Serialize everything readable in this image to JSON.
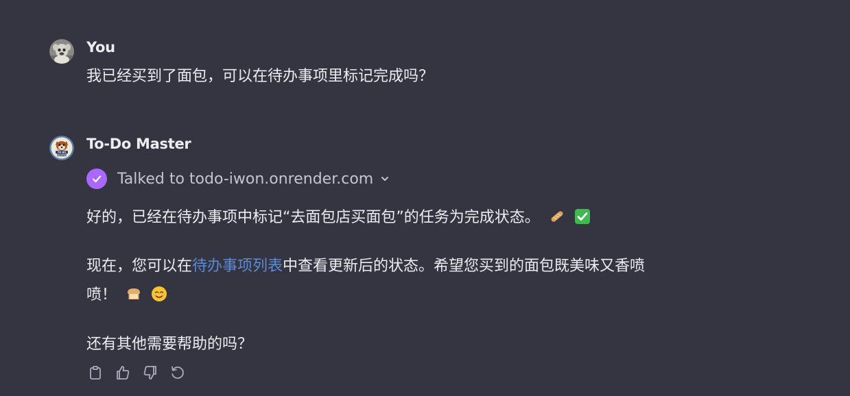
{
  "conversation": {
    "user": {
      "author": "You",
      "avatar_icon": "user-photo-avatar",
      "text": "我已经买到了面包，可以在待办事项里标记完成吗？"
    },
    "assistant": {
      "author": "To-Do Master",
      "avatar_icon": "todo-master-logo-avatar",
      "tool_call": {
        "label": "Talked to todo-iwon.onrender.com",
        "status_icon": "check-icon",
        "accent_color": "#ab68ff"
      },
      "paragraph1": {
        "text": "好的，已经在待办事项中标记“去面包店买面包”的任务为完成状态。",
        "emojis": [
          "baguette-emoji",
          "check-mark-button-emoji"
        ]
      },
      "paragraph2": {
        "before_link": "现在，您可以在",
        "link_text": "待办事项列表",
        "after_link": "中查看更新后的状态。希望您买到的面包既美味又香喷",
        "continuation": "喷！",
        "emojis": [
          "bread-emoji",
          "smiling-face-emoji"
        ]
      },
      "paragraph3": {
        "text": "还有其他需要帮助的吗？"
      },
      "actions": [
        "copy-icon",
        "thumbs-up-icon",
        "thumbs-down-icon",
        "regenerate-icon"
      ]
    }
  },
  "colors": {
    "background": "#343541",
    "text": "#ececf1",
    "link": "#5b8bd6"
  }
}
